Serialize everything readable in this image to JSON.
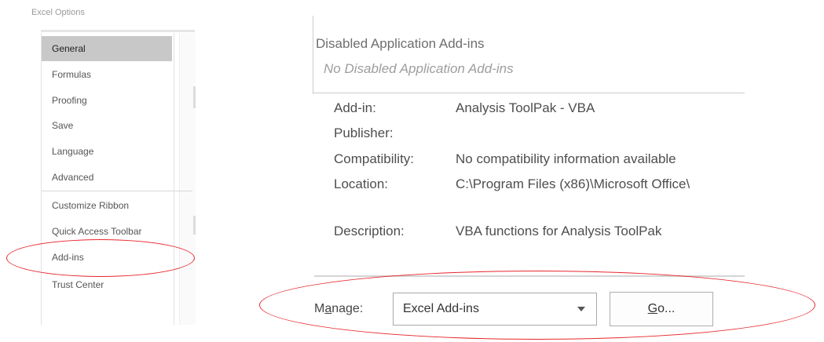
{
  "window": {
    "title": "Excel Options"
  },
  "sidebar": {
    "items": [
      {
        "label": "General",
        "selected": true
      },
      {
        "label": "Formulas"
      },
      {
        "label": "Proofing"
      },
      {
        "label": "Save"
      },
      {
        "label": "Language"
      },
      {
        "label": "Advanced"
      },
      {
        "label": "Customize Ribbon"
      },
      {
        "label": "Quick Access Toolbar"
      },
      {
        "label": "Add-ins",
        "highlighted": true
      },
      {
        "label": "Trust Center"
      }
    ]
  },
  "disabled_addins": {
    "title": "Disabled Application Add-ins",
    "empty_text": "No Disabled Application Add-ins"
  },
  "details": {
    "addin_label": "Add-in:",
    "addin_value": "Analysis ToolPak - VBA",
    "publisher_label": "Publisher:",
    "publisher_value": "",
    "compatibility_label": "Compatibility:",
    "compatibility_value": "No compatibility information available",
    "location_label": "Location:",
    "location_value": "C:\\Program Files (x86)\\Microsoft Office\\",
    "description_label": "Description:",
    "description_value": "VBA functions for Analysis ToolPak"
  },
  "manage": {
    "label_pre": "M",
    "label_accel": "a",
    "label_post": "nage:",
    "selected_option": "Excel Add-ins",
    "go_accel": "G",
    "go_rest": "o..."
  },
  "colors": {
    "annotation": "#e8262c",
    "selected_bg": "#c8c8c8"
  }
}
